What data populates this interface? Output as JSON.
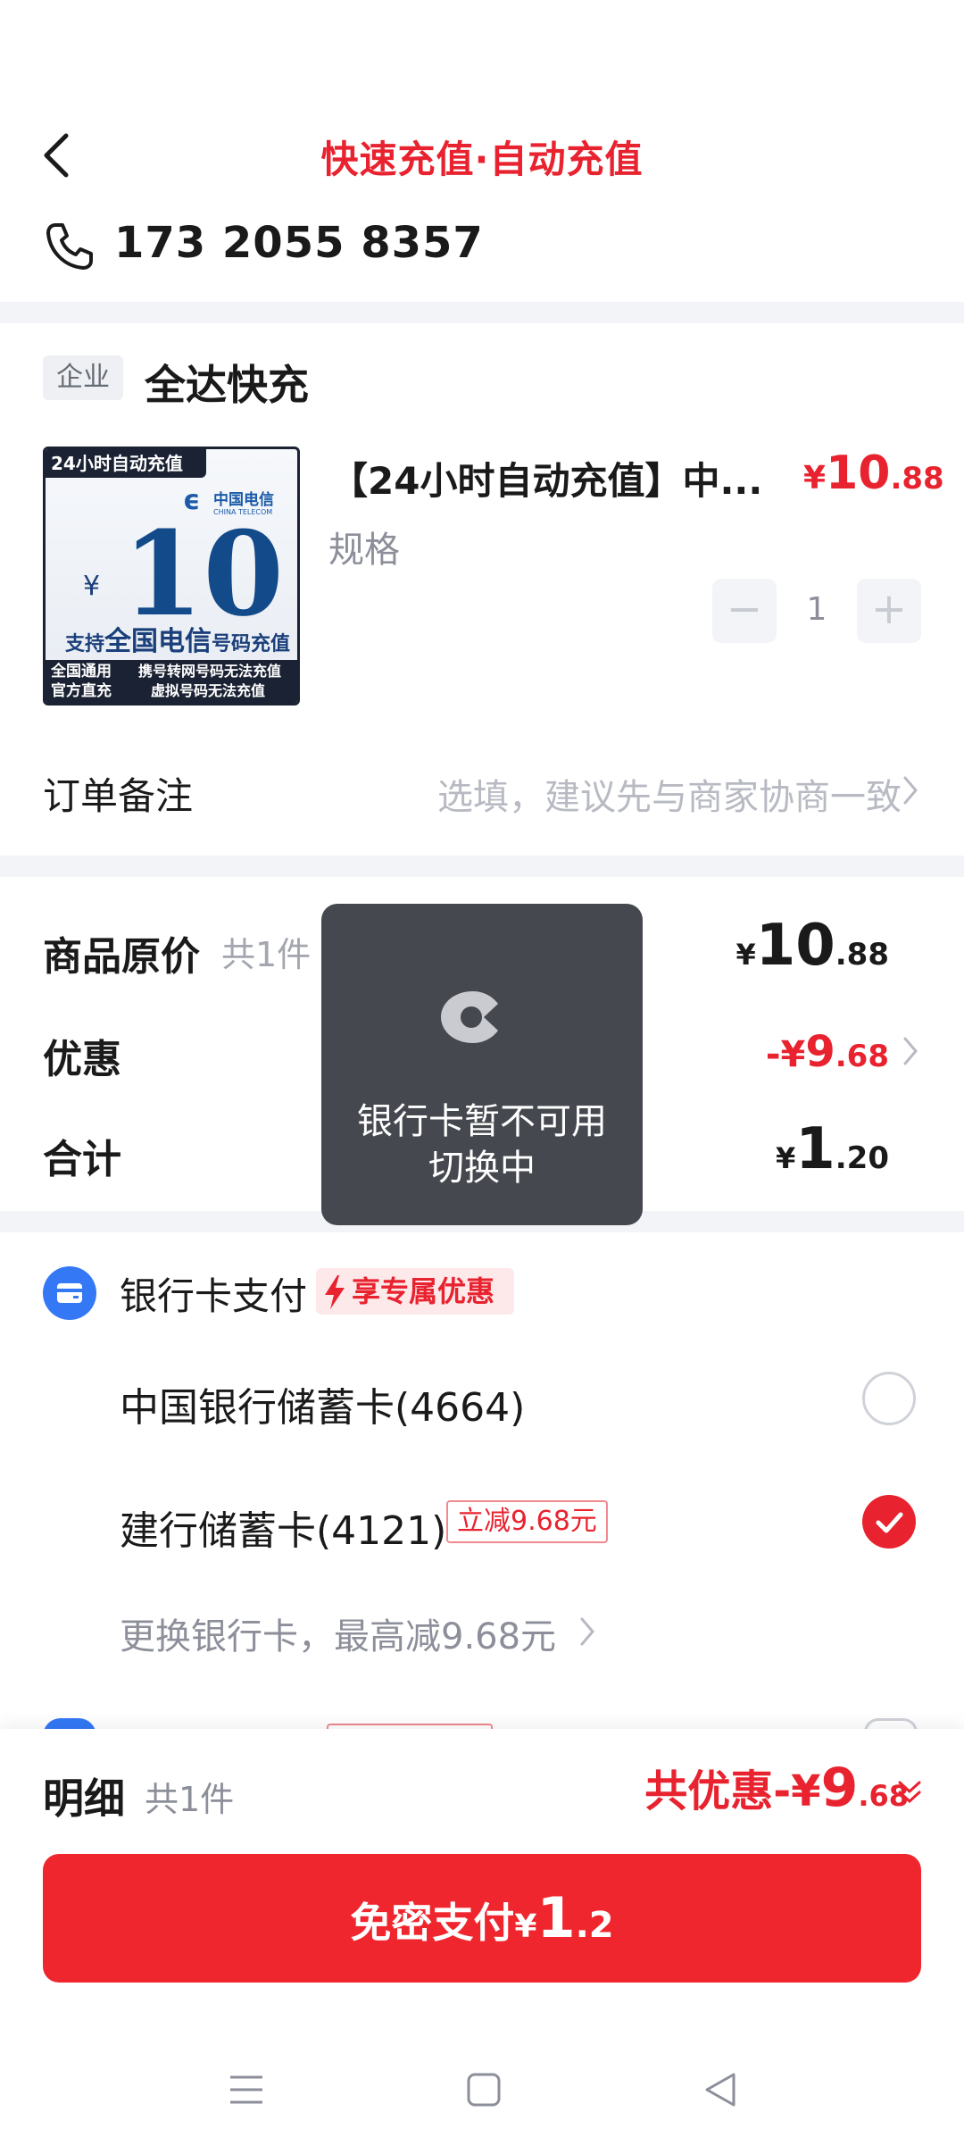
{
  "header": {
    "title": "快速充值·自动充值",
    "phone_number": "173 2055 8357"
  },
  "store": {
    "badge": "企业",
    "name": "全达快充"
  },
  "product": {
    "image": {
      "banner": "24小时自动充值",
      "brand_cn": "中国电信",
      "brand_en": "CHINA TELECOM",
      "currency": "¥",
      "face_value": "10",
      "support_prefix": "支持",
      "support_bold": "全国电信",
      "support_suffix": "号码充值",
      "bottom_left_1": "全国通用",
      "bottom_left_2": "官方直充",
      "bottom_right_1": "携号转网号码无法充值",
      "bottom_right_2": "虚拟号码无法充值"
    },
    "title": "【24小时自动充值】中...",
    "price_currency": "¥",
    "price_int": "10",
    "price_dec": ".88",
    "spec_label": "规格",
    "quantity": "1",
    "minus": "−",
    "plus": "+"
  },
  "remark": {
    "label": "订单备注",
    "placeholder": "选填，建议先与商家协商一致"
  },
  "summary": {
    "original_label": "商品原价",
    "original_count": "共1件",
    "original_cur": "¥",
    "original_int": "10",
    "original_dec": ".88",
    "discount_label": "优惠",
    "discount_prefix": "-¥",
    "discount_int": "9",
    "discount_dec": ".68",
    "total_label": "合计",
    "total_cur": "¥",
    "total_int": "1",
    "total_dec": ".20"
  },
  "toast": {
    "line1": "银行卡暂不可用",
    "line2": "切换中"
  },
  "payment": {
    "title": "银行卡支付",
    "promo_tag": "享专属优惠",
    "cards": [
      {
        "name": "中国银行储蓄卡(4664)",
        "selected": false
      },
      {
        "name": "建行储蓄卡(4121)",
        "selected": true,
        "tag": "立减9.68元"
      }
    ],
    "change_card": "更换银行卡，最高减9.68元"
  },
  "footer": {
    "detail_label": "明细",
    "detail_count": "共1件",
    "total_discount_label": "共优惠-¥",
    "total_discount_int": "9",
    "total_discount_dec": ".68",
    "pay_label": "免密支付",
    "pay_cur": "¥",
    "pay_int": "1",
    "pay_dec": ".2"
  },
  "colors": {
    "accent_red": "#e8232f",
    "card_blue": "#3478f6",
    "toast_bg": "#45484e"
  },
  "icons": [
    "back-icon",
    "phone-icon",
    "chevron-right-icon",
    "loading-icon",
    "bank-card-icon",
    "lightning-icon",
    "radio-icon",
    "checkmark-icon",
    "double-chevron-down-icon",
    "menu-icon",
    "home-icon",
    "back-triangle-icon"
  ]
}
